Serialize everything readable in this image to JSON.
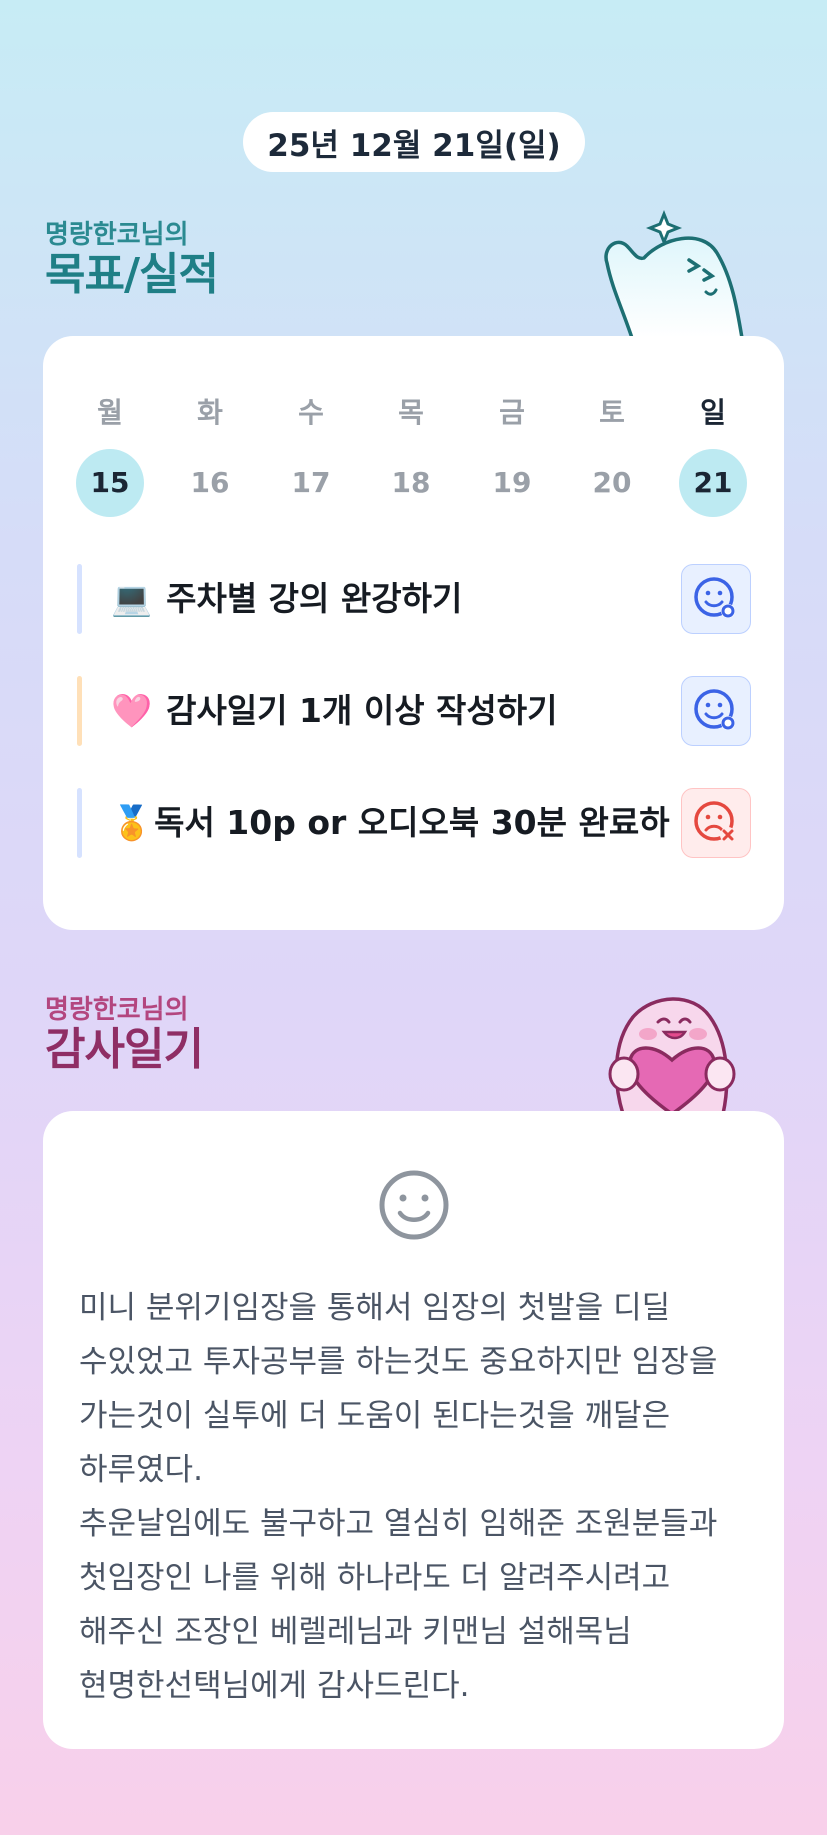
{
  "date": "25년 12월 21일(일)",
  "goals_section": {
    "subtitle": "명랑한코님의",
    "title": "목표/실적"
  },
  "week": [
    {
      "day": "월",
      "num": "15",
      "active": true
    },
    {
      "day": "화",
      "num": "16",
      "active": false
    },
    {
      "day": "수",
      "num": "17",
      "active": false
    },
    {
      "day": "목",
      "num": "18",
      "active": false
    },
    {
      "day": "금",
      "num": "19",
      "active": false
    },
    {
      "day": "토",
      "num": "20",
      "active": false
    },
    {
      "day": "일",
      "num": "21",
      "active": true
    }
  ],
  "goals": [
    {
      "emoji": "💻",
      "text": "주차별 강의 완강하기",
      "status": "achieved",
      "bar_color": "#d6e2ff"
    },
    {
      "emoji": "🩷",
      "text": "감사일기 1개 이상 작성하기",
      "status": "achieved",
      "bar_color": "#ffe0b8"
    },
    {
      "emoji": "🏅",
      "text": "독서 10p or 오디오북 30분 완료하",
      "status": "failed",
      "bar_color": "#d6e2ff"
    }
  ],
  "diary_section": {
    "subtitle": "명랑한코님의",
    "title": "감사일기"
  },
  "diary": {
    "mood_icon": "smile-icon",
    "text": "미니 분위기임장을 통해서 임장의 첫발을 디딜 수있었고 투자공부를 하는것도 중요하지만 임장을 가는것이 실투에 더 도움이 된다는것을 깨달은 하루였다.\n추운날임에도 불구하고 열심히 임해준 조원분들과 첫임장인 나를 위해 하나라도 더 알려주시려고 해주신 조장인 베렐레님과 키맨님 설해목님 현명한선택님에게 감사드린다."
  },
  "colors": {
    "accent_teal": "#1f7f86",
    "accent_pink": "#8f2e65",
    "ok_blue": "#3b63e6",
    "fail_red": "#e5483f"
  }
}
